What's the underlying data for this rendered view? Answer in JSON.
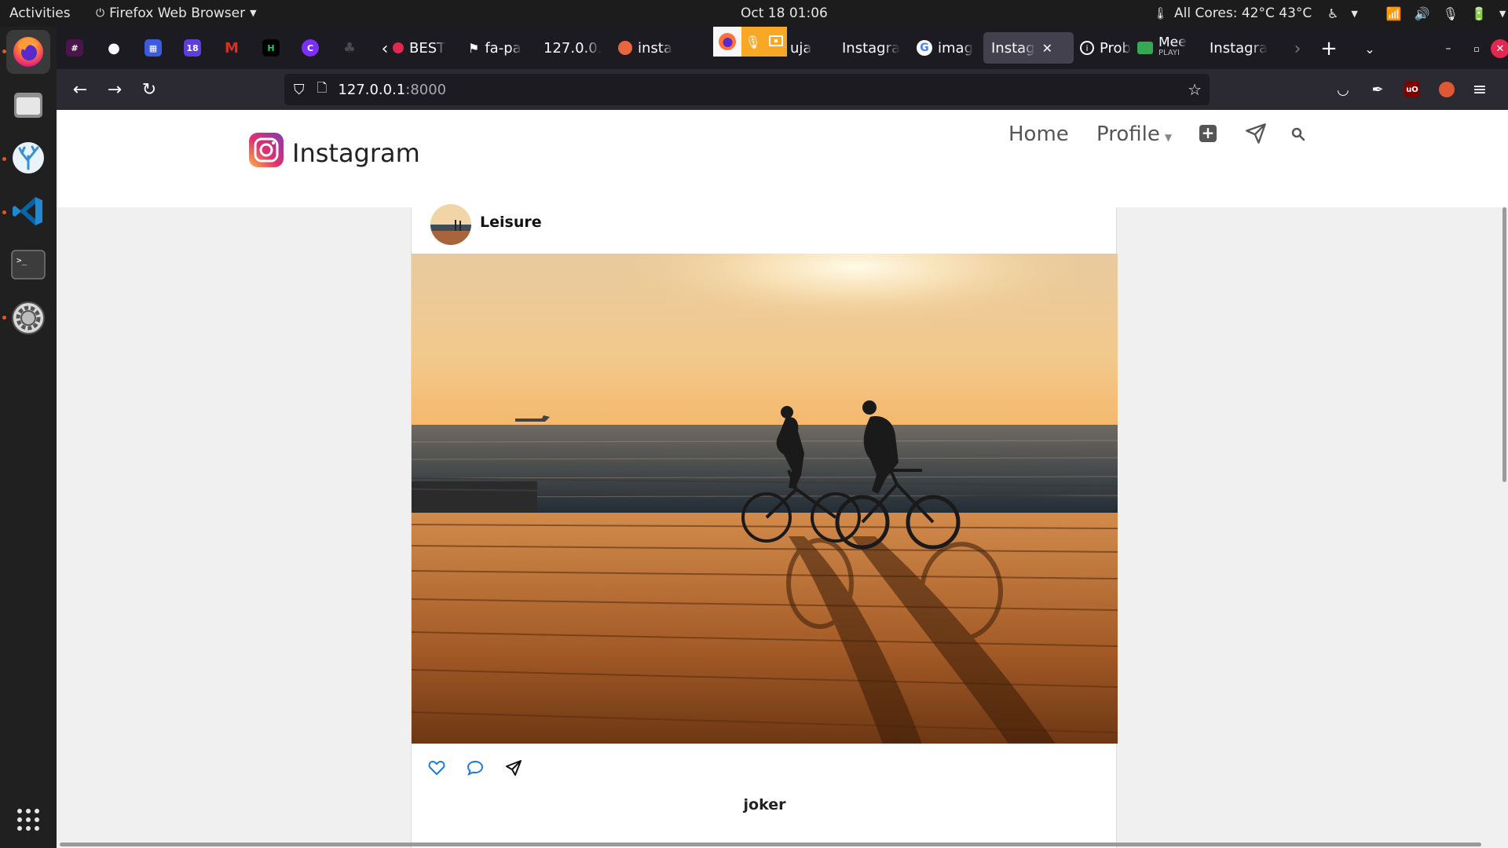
{
  "topbar": {
    "activities": "Activities",
    "app_menu": "Firefox Web Browser",
    "clock": "Oct 18  01:06",
    "cpu": "All Cores: 42°C 43°C"
  },
  "browser": {
    "tabs": [
      {
        "label": "BEST",
        "color": "#e22850"
      },
      {
        "label": "fa-pa",
        "color": "#ffffff"
      },
      {
        "label": "127.0.0.",
        "color": ""
      },
      {
        "label": "insta",
        "color": "#e8663d"
      },
      {
        "label": "uja",
        "color": ""
      },
      {
        "label": "Instagra",
        "color": ""
      },
      {
        "label": "imag",
        "color": "#4285f4"
      },
      {
        "label": "Instag",
        "color": ""
      },
      {
        "label": "Prob",
        "color": "#fbfbfe"
      },
      {
        "label": "Mee",
        "sub": "PLAYI",
        "color": "#34a853"
      },
      {
        "label": "Instagra",
        "color": ""
      }
    ],
    "url_host": "127.0.0.1",
    "url_port": ":8000"
  },
  "site": {
    "brand": "Instagram",
    "nav": {
      "home": "Home",
      "profile": "Profile"
    },
    "colors": {
      "link": "#1d7bd8"
    }
  },
  "post": {
    "username": "Leisure",
    "caption": "joker"
  }
}
